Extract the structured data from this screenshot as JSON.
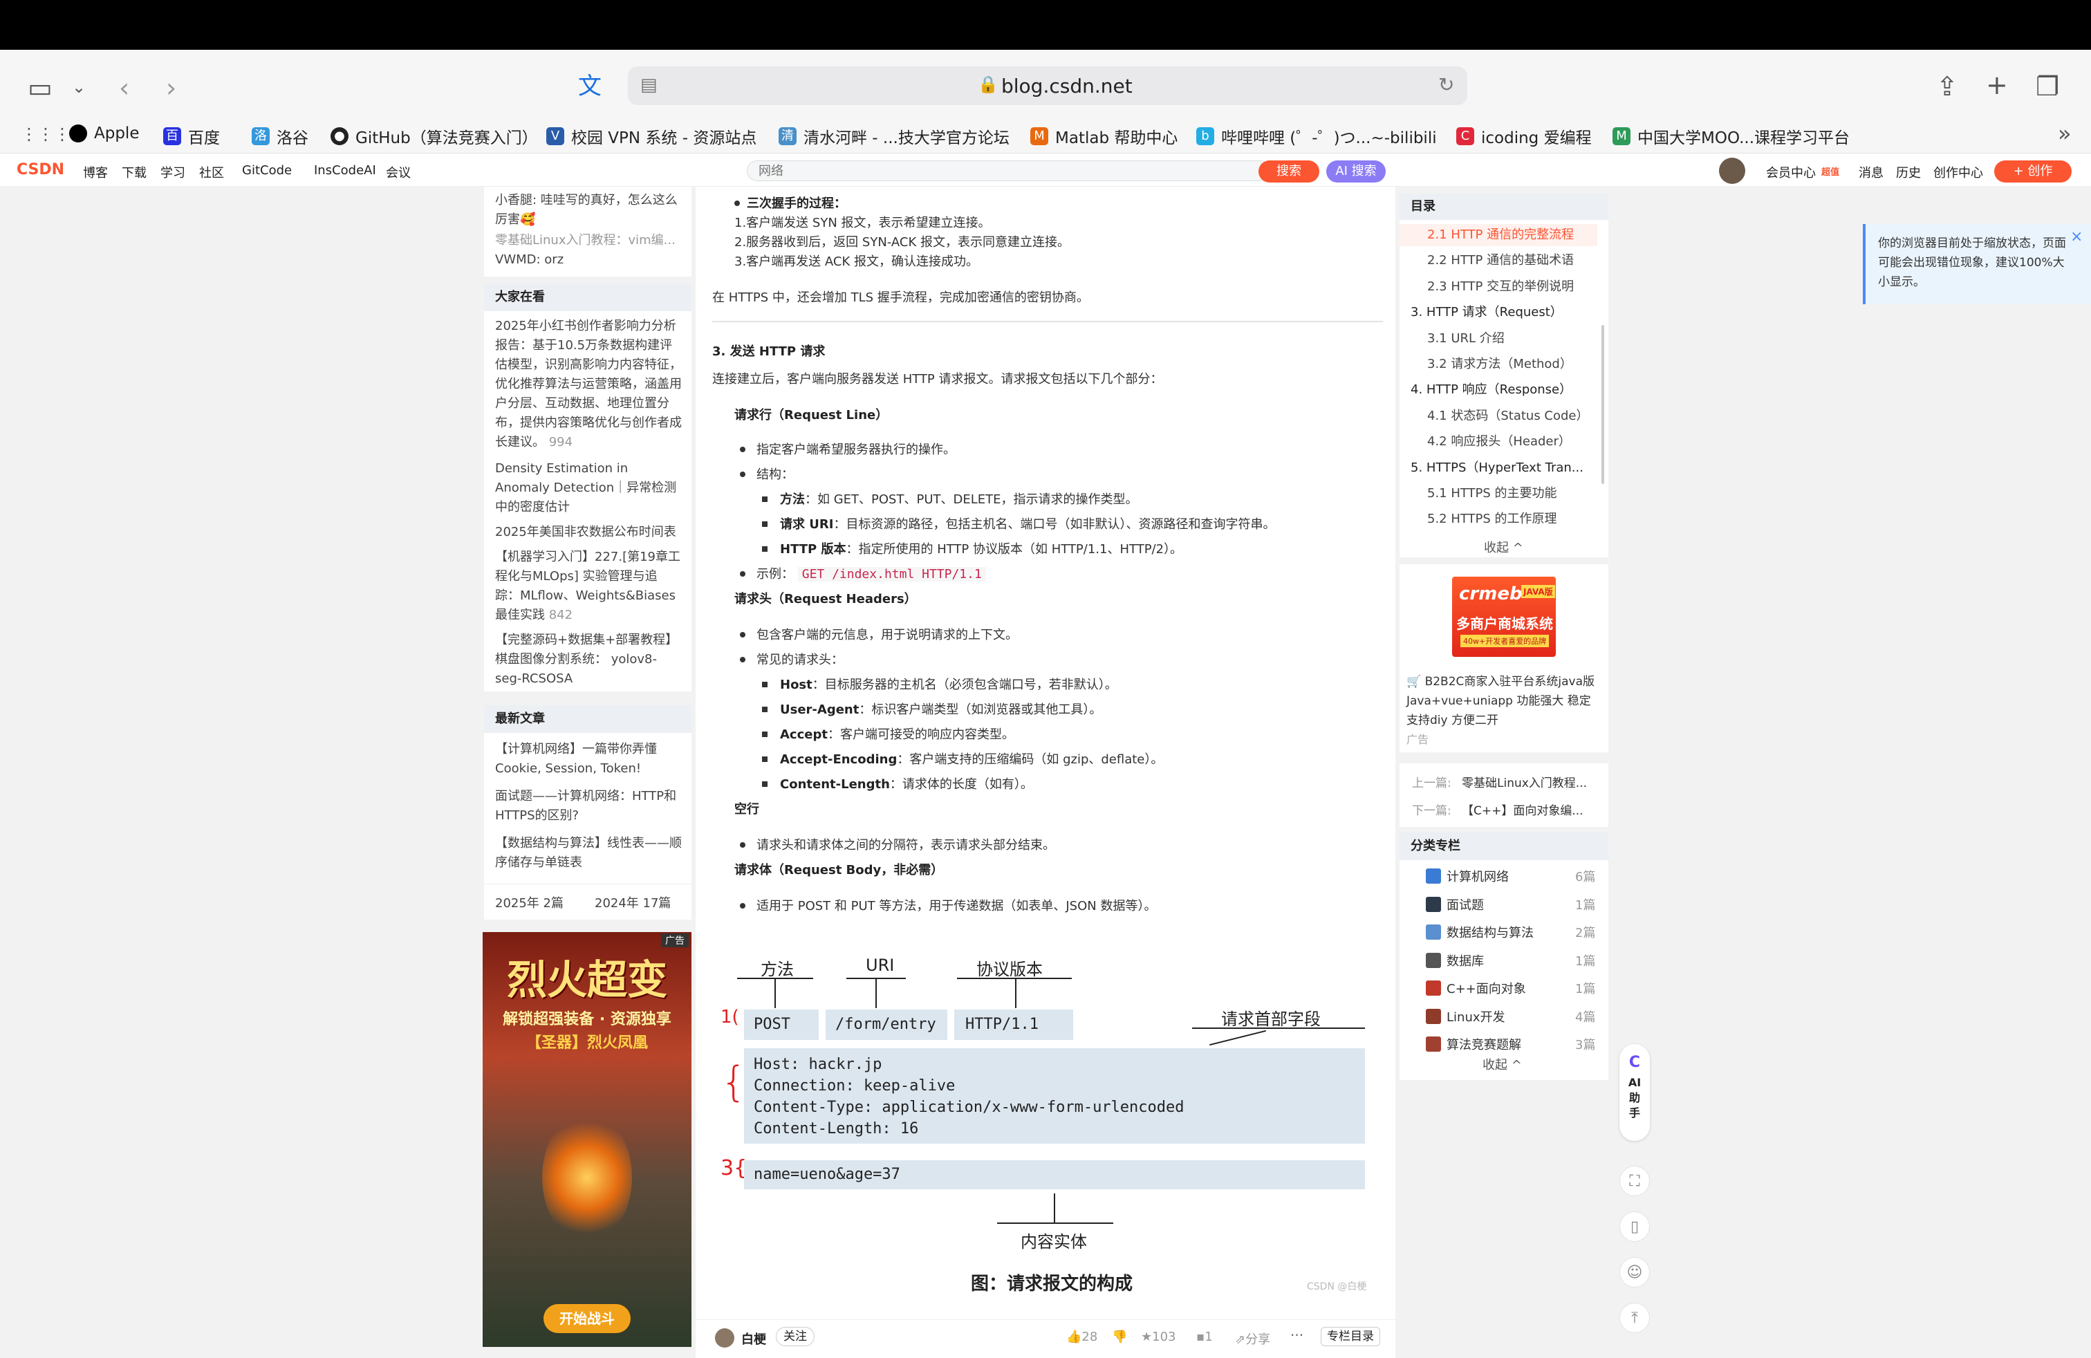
{
  "browser": {
    "url": "blog.csdn.net",
    "bookmarks": [
      "Apple",
      "百度",
      "洛谷",
      "GitHub（算法竞赛入门）",
      "校园 VPN 系统 - 资源站点",
      "清水河畔 - ...技大学官方论坛",
      "Matlab 帮助中心",
      "哔哩哔哩 (゜-゜)つ...~-bilibili",
      "icoding 爱编程",
      "中国大学MOO...课程学习平台"
    ]
  },
  "csdn_nav": {
    "logo": "CSDN",
    "items": [
      "博客",
      "下载",
      "学习",
      "社区",
      "GitCode",
      "InsCodeAI",
      "会议"
    ],
    "search_placeholder": "网络",
    "search_btn": "搜索",
    "ai_search_btn": "AI 搜索",
    "right": [
      "会员中心",
      "消息",
      "历史",
      "创作中心"
    ],
    "vip_badge": "超值",
    "create_btn": "+ 创作"
  },
  "left": {
    "top_comments": [
      "小香腿: 哇哇写的真好，怎么这么厉害🥰",
      "零基础Linux入门教程：vim编...",
      "VWMD: orz"
    ],
    "popular_title": "大家在看",
    "popular": [
      {
        "text": "2025年小红书创作者影响力分析报告：基于10.5万条数据构建评估模型，识别高影响力内容特征，优化推荐算法与运营策略，涵盖用户分层、互动数据、地理位置分布，提供内容策略优化与创作者成长建议。",
        "views": "994"
      },
      {
        "text": "Density Estimation in Anomaly Detection｜异常检测中的密度估计",
        "views": ""
      },
      {
        "text": "2025年美国非农数据公布时间表",
        "views": ""
      },
      {
        "text": "【机器学习入门】227.[第19章工程化与MLOps] 实验管理与追踪：MLflow、Weights&Biases 最佳实践",
        "views": "842"
      },
      {
        "text": "【完整源码+数据集+部署教程】棋盘图像分割系统： yolov8-seg-RCSOSA",
        "views": ""
      }
    ],
    "recent_title": "最新文章",
    "recent": [
      "【计算机网络】一篇带你弄懂Cookie, Session, Token!",
      "面试题——计算机网络：HTTP和HTTPS的区别?",
      "【数据结构与算法】线性表——顺序储存与单链表"
    ],
    "archive": [
      "2025年 2篇",
      "2024年 17篇"
    ],
    "ad_label": "广告",
    "ad_title": "烈火超变",
    "ad_sub": "解锁超强装备 · 资源独享",
    "ad_sub2": "【圣器】烈火凤凰",
    "ad_btn": "开始战斗"
  },
  "article": {
    "handshake_title": "三次握手的过程：",
    "handshake": [
      "1.客户端发送 SYN 报文，表示希望建立连接。",
      "2.服务器收到后，返回 SYN-ACK 报文，表示同意建立连接。",
      "3.客户端再发送 ACK 报文，确认连接成功。"
    ],
    "tls_note": "在 HTTPS 中，还会增加 TLS 握手流程，完成加密通信的密钥协商。",
    "section3_title": "3. 发送 HTTP 请求",
    "section3_intro": "连接建立后，客户端向服务器发送 HTTP 请求报文。请求报文包括以下几个部分：",
    "req_line_title": "请求行（Request Line）",
    "req_line_items": [
      "指定客户端希望服务器执行的操作。",
      "结构："
    ],
    "req_line_sub": [
      {
        "k": "方法",
        "v": "：如 GET、POST、PUT、DELETE，指示请求的操作类型。"
      },
      {
        "k": "请求 URI",
        "v": "：目标资源的路径，包括主机名、端口号（如非默认）、资源路径和查询字符串。"
      },
      {
        "k": "HTTP 版本",
        "v": "：指定所使用的 HTTP 协议版本（如 HTTP/1.1、HTTP/2）。"
      }
    ],
    "example_label": "示例：",
    "example_code": "GET /index.html HTTP/1.1",
    "req_header_title": "请求头（Request Headers）",
    "req_header_items": [
      "包含客户端的元信息，用于说明请求的上下文。",
      "常见的请求头："
    ],
    "req_header_sub": [
      {
        "k": "Host",
        "v": "：目标服务器的主机名（必须包含端口号，若非默认）。"
      },
      {
        "k": "User-Agent",
        "v": "：标识客户端类型（如浏览器或其他工具）。"
      },
      {
        "k": "Accept",
        "v": "：客户端可接受的响应内容类型。"
      },
      {
        "k": "Accept-Encoding",
        "v": "：客户端支持的压缩编码（如 gzip、deflate）。"
      },
      {
        "k": "Content-Length",
        "v": "：请求体的长度（如有）。"
      }
    ],
    "blank_title": "空行",
    "blank_item": "请求头和请求体之间的分隔符，表示请求头部分结束。",
    "body_title": "请求体（Request Body，非必需）",
    "body_item": "适用于 POST 和 PUT 等方法，用于传递数据（如表单、JSON 数据等）。",
    "figure": {
      "label_method": "方法",
      "label_uri": "URI",
      "label_version": "协议版本",
      "label_headers": "请求首部字段",
      "label_body": "内容实体",
      "method": "POST",
      "uri": "/form/entry",
      "version": "HTTP/1.1",
      "headers": [
        "Host: hackr.jp",
        "Connection: keep-alive",
        "Content-Type: application/x-www-form-urlencoded",
        "Content-Length: 16"
      ],
      "body": "name=ueno&age=37",
      "caption": "图：请求报文的构成",
      "watermark": "CSDN @白梗"
    },
    "footer": {
      "author": "白梗",
      "follow": "关注",
      "likes": "28",
      "stars": "103",
      "comments": "1",
      "share": "分享",
      "more": "···",
      "column": "专栏目录"
    }
  },
  "toc": {
    "title": "目录",
    "items": [
      {
        "t": "2.1 HTTP 通信的完整流程",
        "lvl": 2,
        "active": true
      },
      {
        "t": "2.2 HTTP 通信的基础术语",
        "lvl": 2
      },
      {
        "t": "2.3 HTTP 交互的举例说明",
        "lvl": 2
      },
      {
        "t": "3. HTTP 请求（Request）",
        "lvl": 1
      },
      {
        "t": "3.1 URL 介绍",
        "lvl": 2
      },
      {
        "t": "3.2 请求方法（Method）",
        "lvl": 2
      },
      {
        "t": "4. HTTP 响应（Response）",
        "lvl": 1
      },
      {
        "t": "4.1 状态码（Status Code）",
        "lvl": 2
      },
      {
        "t": "4.2 响应报头（Header）",
        "lvl": 2
      },
      {
        "t": "5. HTTPS（HyperText Tran...",
        "lvl": 1
      },
      {
        "t": "5.1 HTTPS 的主要功能",
        "lvl": 2
      },
      {
        "t": "5.2 HTTPS 的工作原理",
        "lvl": 2
      }
    ],
    "collapse": "收起 ^"
  },
  "right_ad": {
    "brand": "crmeb",
    "tag": "JAVA版",
    "headline": "多商户商城系统",
    "sub": "40w+开发者喜爱的品牌",
    "desc": "🛒 B2B2C商家入驻平台系统java版 Java+vue+uniapp 功能强大 稳定 支持diy 方便二开",
    "ad": "广告"
  },
  "prevnext": {
    "prev_label": "上一篇:",
    "prev": "零基础Linux入门教程...",
    "next_label": "下一篇:",
    "next": "【C++】面向对象编..."
  },
  "categories": {
    "title": "分类专栏",
    "items": [
      {
        "n": "计算机网络",
        "c": "6篇"
      },
      {
        "n": "面试题",
        "c": "1篇"
      },
      {
        "n": "数据结构与算法",
        "c": "2篇"
      },
      {
        "n": "数据库",
        "c": "1篇"
      },
      {
        "n": "C++面向对象",
        "c": "1篇"
      },
      {
        "n": "Linux开发",
        "c": "4篇"
      },
      {
        "n": "算法竞赛题解",
        "c": "3篇"
      }
    ],
    "collapse": "收起 ^"
  },
  "ai_helper": "AI助手",
  "zoom_notice": "你的浏览器目前处于缩放状态，页面可能会出现错位现象，建议100%大小显示。",
  "colors": {
    "csdn_red": "#fc5531",
    "accent_blue": "#4c8bf5",
    "toc_active": "#fc5531",
    "figure_box": "#dce6ef"
  }
}
